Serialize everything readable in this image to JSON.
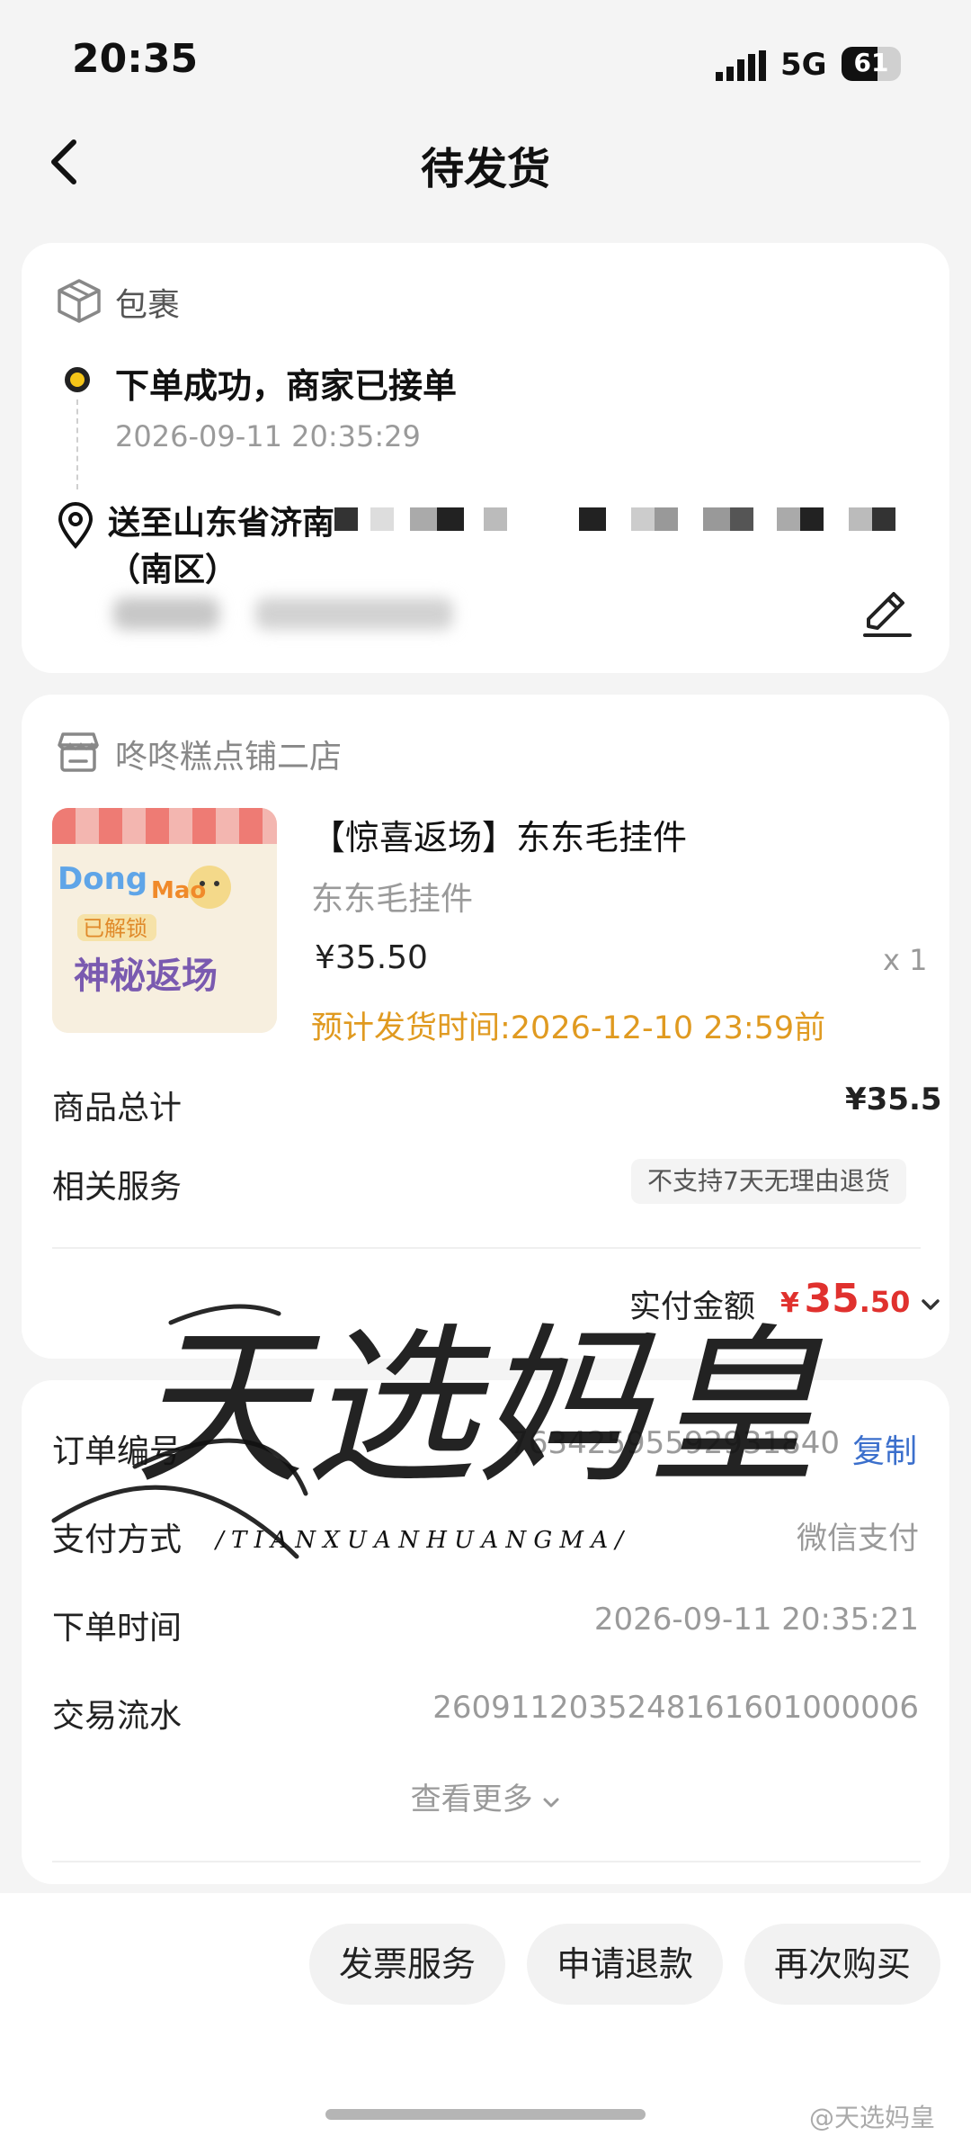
{
  "status_bar": {
    "time": "20:35",
    "network": "5G",
    "battery": "61",
    "battery_level_percent": 61
  },
  "nav": {
    "title": "待发货"
  },
  "package": {
    "label": "包裹",
    "status": "下单成功，商家已接单",
    "status_time": "2026-09-11 20:35:29",
    "address_line1": "送至山东省济南",
    "address_line2": "（南区）"
  },
  "shop": {
    "name": "咚咚糕点铺二店",
    "product": {
      "title": "【惊喜返场】东东毛挂件",
      "subtitle": "东东毛挂件",
      "price": "¥35.50",
      "quantity": "x 1",
      "ship_estimate": "预计发货时间:2026-12-10 23:59前",
      "thumb_text_top": "Dong",
      "thumb_text_top2": "Mao",
      "thumb_badge": "已解锁",
      "thumb_text_main": "神秘返场"
    },
    "total_label": "商品总计",
    "total_value": "¥35.5",
    "service_label": "相关服务",
    "service_tag": "不支持7天无理由退货",
    "paid_label": "实付金额",
    "paid_symbol": "¥",
    "paid_int": "35",
    "paid_dec": ".50"
  },
  "order": {
    "rows": [
      {
        "label": "订单编号",
        "value": "76342595592931840"
      },
      {
        "label": "支付方式",
        "value": "微信支付"
      },
      {
        "label": "下单时间",
        "value": "2026-09-11 20:35:21"
      },
      {
        "label": "交易流水",
        "value": "2609112035248161601000006"
      }
    ],
    "copy_label": "复制",
    "more_label": "查看更多"
  },
  "actions": {
    "invoice": "发票服务",
    "refund": "申请退款",
    "rebuy": "再次购买"
  },
  "watermark": {
    "main": "天选妈皇",
    "sub": "/ T I A N X U A N H U A N G M A /"
  },
  "credit": "@天选妈皇",
  "colors": {
    "accent_red": "#e0312e",
    "ship_orange": "#e09a20",
    "link_blue": "#3b6fcc",
    "status_yellow": "#f5c518"
  }
}
